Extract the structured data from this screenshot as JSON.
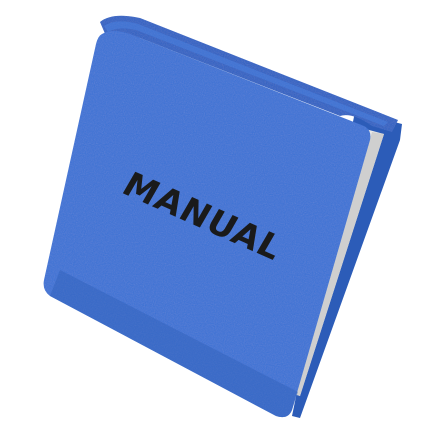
{
  "book": {
    "title": "MANUAL",
    "subject": "book-icon"
  },
  "colors": {
    "background": "#ffffff",
    "cover": "#3a72d6",
    "cover_shade": "#2f5fb8",
    "spine": "#2e62c4",
    "back_edge": "#2c5cb8",
    "pages": "#e6e6e6",
    "title_text": "#1a1a1a"
  }
}
